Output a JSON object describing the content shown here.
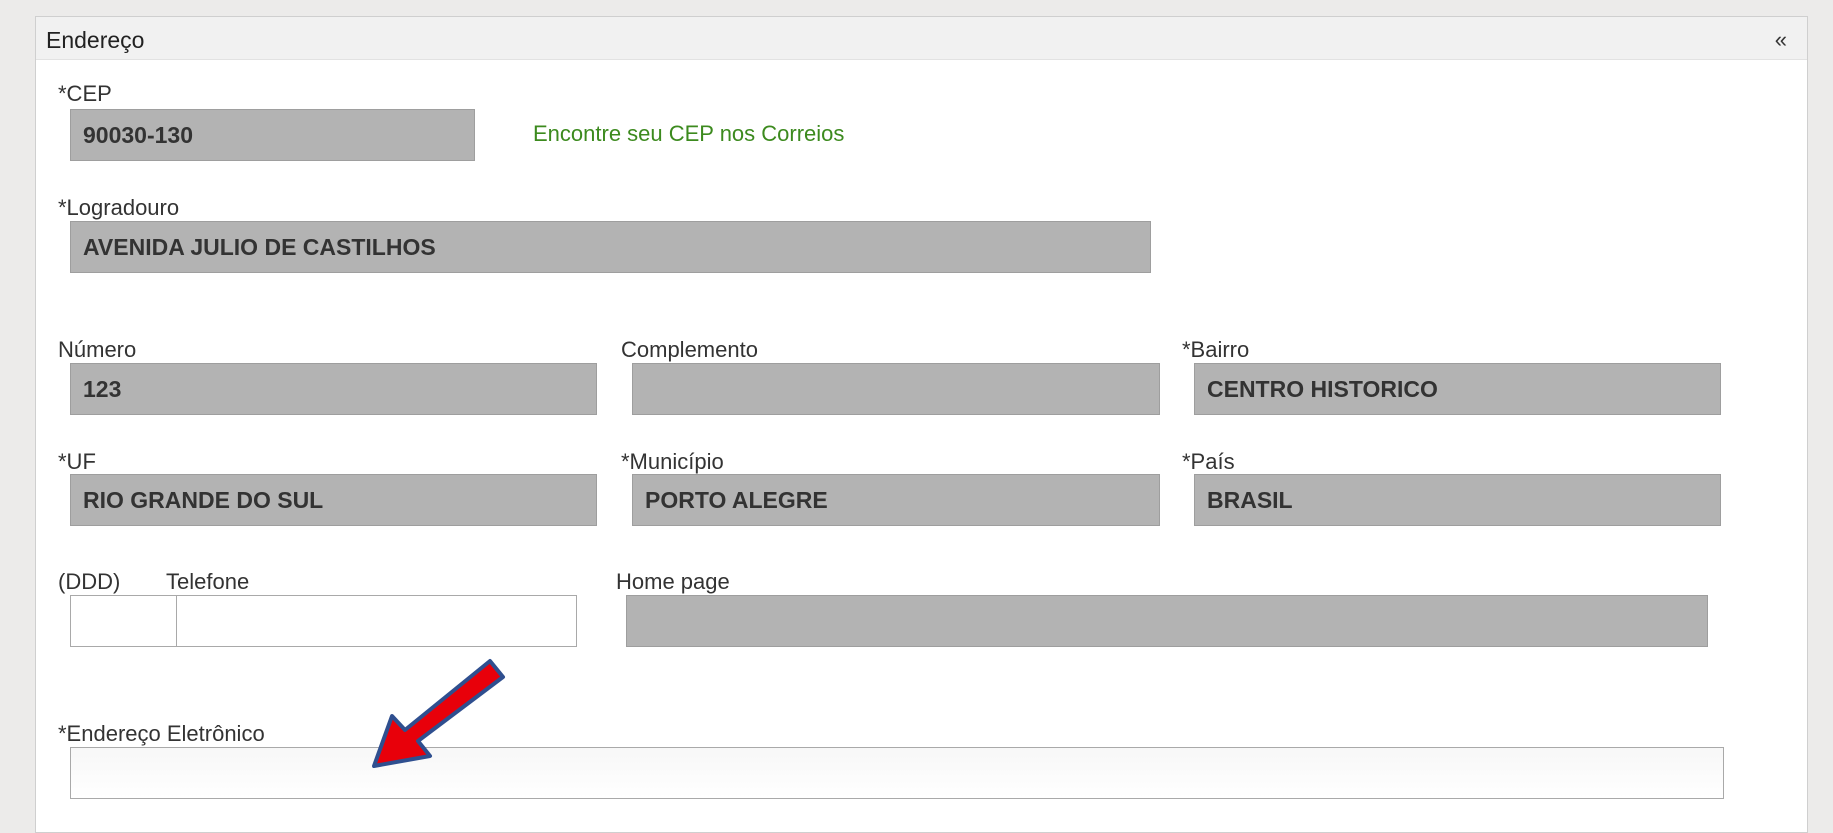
{
  "panel": {
    "title": "Endereço",
    "collapse_glyph": "«"
  },
  "cep": {
    "label": "*CEP",
    "value": "90030-130",
    "link": "Encontre seu CEP nos Correios"
  },
  "logradouro": {
    "label": "*Logradouro",
    "value": "AVENIDA JULIO DE CASTILHOS"
  },
  "numero": {
    "label": "Número",
    "value": "123"
  },
  "complemento": {
    "label": "Complemento",
    "value": ""
  },
  "bairro": {
    "label": "*Bairro",
    "value": "CENTRO HISTORICO"
  },
  "uf": {
    "label": "*UF",
    "value": "RIO GRANDE DO SUL"
  },
  "municipio": {
    "label": "*Município",
    "value": "PORTO ALEGRE"
  },
  "pais": {
    "label": "*País",
    "value": "BRASIL"
  },
  "telefone": {
    "ddd_label": "(DDD)",
    "label": "Telefone",
    "ddd_value": "",
    "value": ""
  },
  "homepage": {
    "label": "Home page",
    "value": ""
  },
  "email": {
    "label": "*Endereço Eletrônico",
    "value": ""
  },
  "colors": {
    "readonly_field_bg": "#b3b3b3",
    "link_green": "#3c8a1e",
    "arrow_red": "#e8000a",
    "arrow_outline": "#2f4f8f"
  },
  "annotation": {
    "icon": "red-arrow-icon"
  }
}
